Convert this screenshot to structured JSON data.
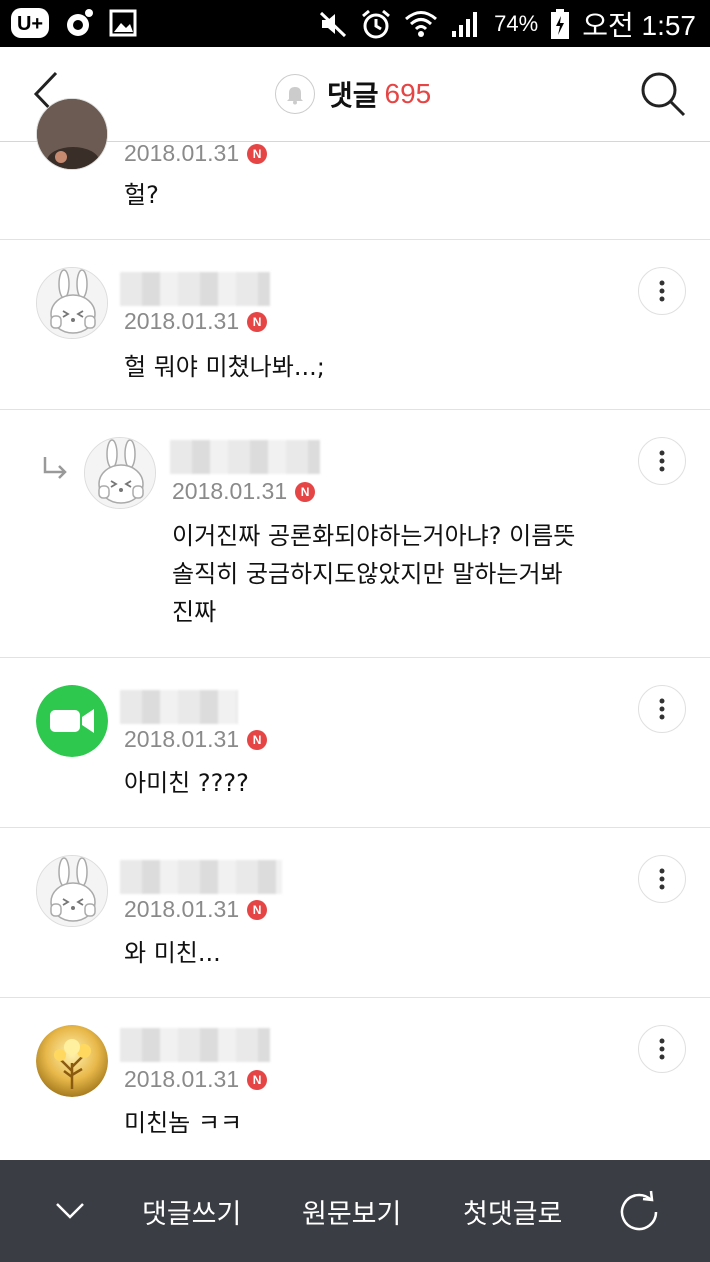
{
  "status_bar": {
    "battery": "74%",
    "time": "오전 1:57",
    "icons": [
      "u-plus-icon",
      "record-icon",
      "image-icon",
      "mute-icon",
      "alarm-icon",
      "wifi-icon",
      "signal-icon",
      "battery-icon"
    ]
  },
  "header": {
    "title": "댓글",
    "count": "695",
    "back_icon": "back-chevron-icon",
    "search_icon": "search-icon",
    "bell_icon": "bell-icon"
  },
  "comments": [
    {
      "date": "2018.01.31",
      "badge": "N",
      "text": "헐?",
      "avatar": "photo"
    },
    {
      "date": "2018.01.31",
      "badge": "N",
      "text": "헐 뭐야 미쳤나봐...;",
      "avatar": "rabbit"
    },
    {
      "date": "2018.01.31",
      "badge": "N",
      "text_lines": [
        "이거진짜 공론화되야하는거아냐? 이름뜻",
        "솔직히 궁금하지도않았지만 말하는거봐",
        "진짜"
      ],
      "avatar": "rabbit",
      "reply": true
    },
    {
      "date": "2018.01.31",
      "badge": "N",
      "text": "아미친 ????",
      "avatar": "facetime"
    },
    {
      "date": "2018.01.31",
      "badge": "N",
      "text": "와 미친...",
      "avatar": "rabbit"
    },
    {
      "date": "2018.01.31",
      "badge": "N",
      "text": "미친놈 ㅋㅋ",
      "avatar": "golden-tree"
    }
  ],
  "bottom_bar": {
    "collapse_icon": "chevron-down-icon",
    "write_label": "댓글쓰기",
    "original_label": "원문보기",
    "first_label": "첫댓글로",
    "refresh_icon": "refresh-icon"
  },
  "colors": {
    "accent": "#e64545",
    "bottom_bar": "#3a3d44",
    "facetime_green": "#2dc84d"
  }
}
